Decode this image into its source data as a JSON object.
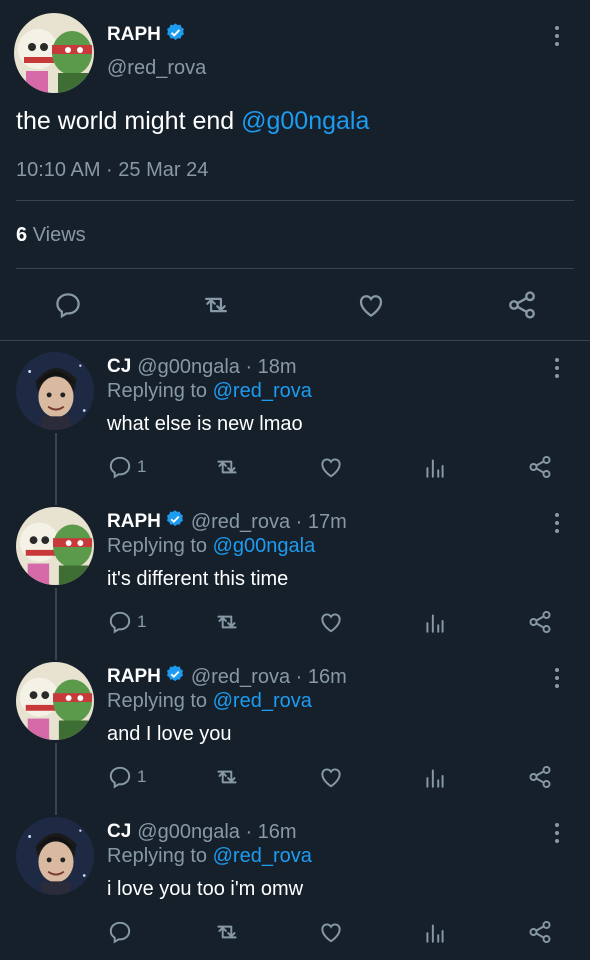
{
  "main_tweet": {
    "name": "RAPH",
    "handle": "@red_rova",
    "text_prefix": "the world might end ",
    "mention": "@g00ngala",
    "timestamp": "10:10 AM · 25 Mar 24",
    "views_count": "6",
    "views_label": "Views"
  },
  "replies": [
    {
      "name": "CJ",
      "handle_time": "@g00ngala · 18m",
      "replying_prefix": "Replying to ",
      "replying_to": "@red_rova",
      "text": "what else is new lmao",
      "reply_count": "1"
    },
    {
      "name": "RAPH",
      "handle_time": "@red_rova · 17m",
      "replying_prefix": "Replying to ",
      "replying_to": "@g00ngala",
      "text": "it's different this time",
      "reply_count": "1"
    },
    {
      "name": "RAPH",
      "handle_time": "@red_rova · 16m",
      "replying_prefix": "Replying to ",
      "replying_to": "@red_rova",
      "text": "and I love you",
      "reply_count": "1"
    },
    {
      "name": "CJ",
      "handle_time": "@g00ngala · 16m",
      "replying_prefix": "Replying to ",
      "replying_to": "@red_rova",
      "text": "i love you too i'm omw",
      "reply_count": ""
    }
  ],
  "colors": {
    "background": "#15202b",
    "accent": "#1d9bf0",
    "muted": "#8899a6",
    "divider": "#38444d"
  },
  "icons": [
    "verified-badge-icon",
    "more-icon",
    "reply-icon",
    "retweet-icon",
    "like-icon",
    "share-icon",
    "views-icon"
  ]
}
